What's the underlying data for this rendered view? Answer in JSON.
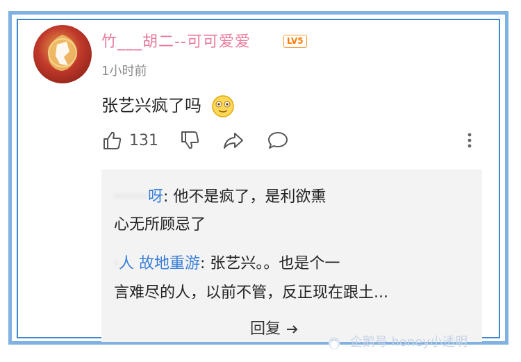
{
  "comment": {
    "username": "竹___胡二--可可爱爱",
    "level": "LV5",
    "time": "1小时前",
    "text": "张艺兴疯了吗",
    "likes": "131"
  },
  "replies": [
    {
      "author": "呀",
      "author_prefix": "·······",
      "line1": ": 他不是疯了，是利欲熏",
      "line2": "心无所顾忌了"
    },
    {
      "author": "人 故地重游",
      "author_prefix": "·",
      "line1": ": 张艺兴。。也是个一",
      "line2": "言难尽的人，以前不管，反正现在跟土..."
    }
  ],
  "reply_link": "回复",
  "watermark": "企鹅号 honey小透明",
  "colors": {
    "frame_outer": "#7fb2e3",
    "frame_inner": "#3f86d2",
    "level_badge": "#ff7a00",
    "author": "#3a7fd8"
  },
  "icons": [
    "thumbs-up-icon",
    "thumbs-down-icon",
    "share-icon",
    "comment-icon",
    "more-vertical-icon",
    "emoji-smile-icon"
  ]
}
